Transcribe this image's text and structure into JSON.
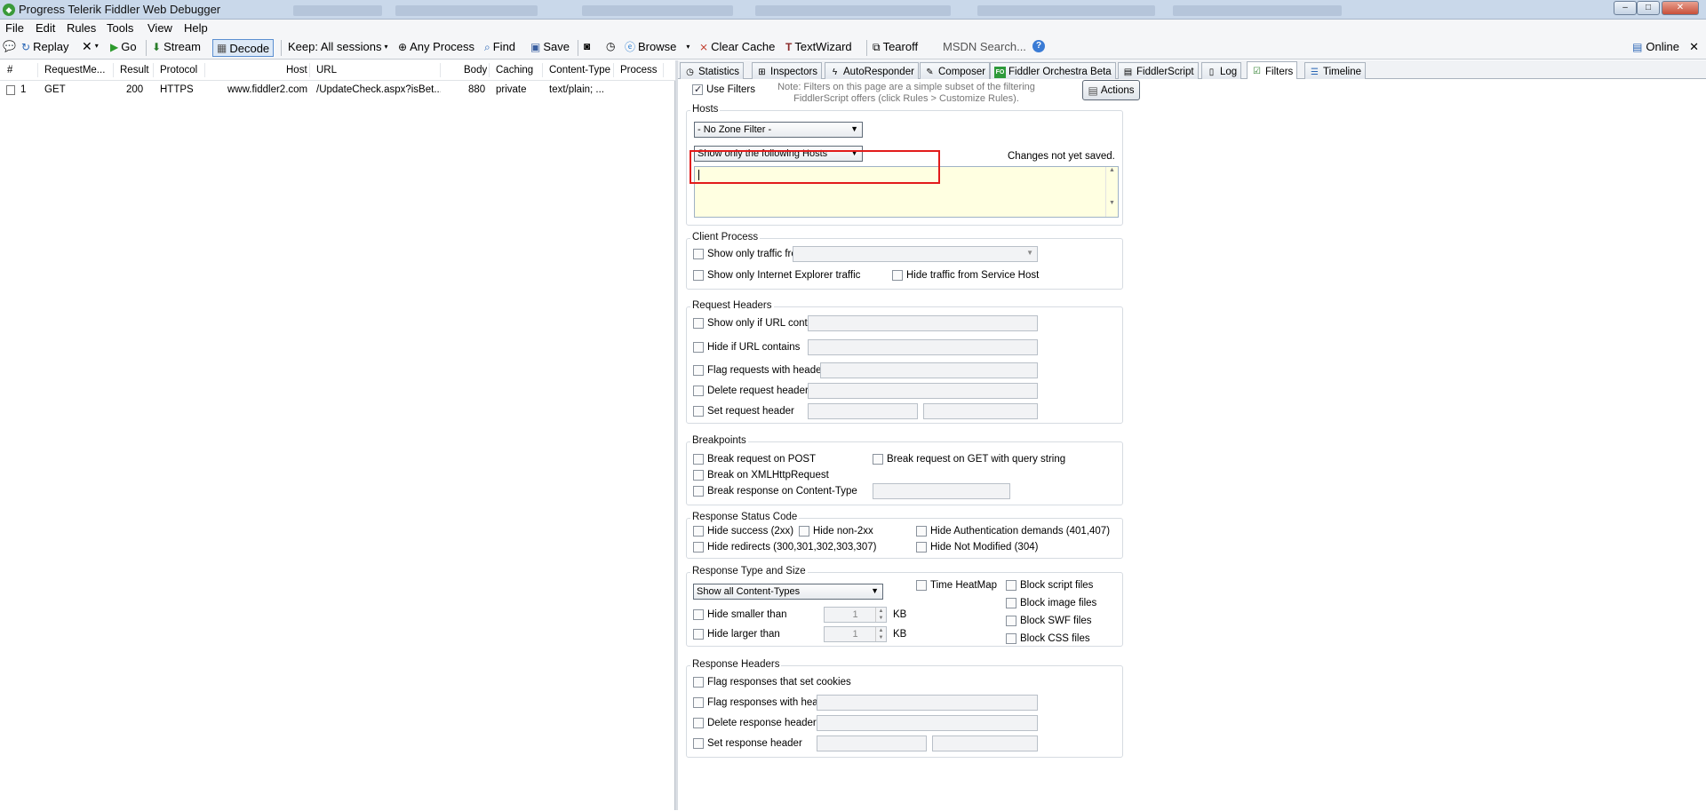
{
  "window": {
    "title": "Progress Telerik Fiddler Web Debugger"
  },
  "menu": [
    "File",
    "Edit",
    "Rules",
    "Tools",
    "View",
    "Help"
  ],
  "toolbar": {
    "replay": "Replay",
    "go": "Go",
    "stream": "Stream",
    "decode": "Decode",
    "keep": "Keep: All sessions",
    "any_process": "Any Process",
    "find": "Find",
    "save": "Save",
    "browse": "Browse",
    "clear_cache": "Clear Cache",
    "text_wizard": "TextWizard",
    "tearoff": "Tearoff",
    "msdn_search": "MSDN Search...",
    "online": "Online"
  },
  "sessions": {
    "columns": [
      "#",
      "RequestMe...",
      "Result",
      "Protocol",
      "Host",
      "URL",
      "Body",
      "Caching",
      "Content-Type",
      "Process"
    ],
    "rows": [
      {
        "id": "1",
        "method": "GET",
        "result": "200",
        "protocol": "HTTPS",
        "host": "www.fiddler2.com",
        "url": "/UpdateCheck.aspx?isBet...",
        "body": "880",
        "caching": "private",
        "content_type": "text/plain; ...",
        "process": ""
      }
    ]
  },
  "tabs": [
    "Statistics",
    "Inspectors",
    "AutoResponder",
    "Composer",
    "Fiddler Orchestra Beta",
    "FiddlerScript",
    "Log",
    "Filters",
    "Timeline"
  ],
  "tab_icons": {
    "fiddler_orchestra": "FO"
  },
  "filters": {
    "use_filters": "Use Filters",
    "note": "Note: Filters on this page are a simple subset of the filtering FiddlerScript offers (click Rules > Customize Rules).",
    "actions": "Actions",
    "hosts": {
      "title": "Hosts",
      "zone_filter": "- No Zone Filter -",
      "host_filter": "Show only the following Hosts",
      "changes_status": "Changes not yet saved."
    },
    "client_process": {
      "title": "Client Process",
      "show_only_traffic_from": "Show only traffic from",
      "show_only_ie": "Show only Internet Explorer traffic",
      "hide_service_host": "Hide traffic from Service Host"
    },
    "request_headers": {
      "title": "Request Headers",
      "show_if_url": "Show only if URL contains",
      "hide_if_url": "Hide if URL contains",
      "flag_requests": "Flag requests with headers",
      "delete_request": "Delete request headers",
      "set_request": "Set request header"
    },
    "breakpoints": {
      "title": "Breakpoints",
      "post": "Break request on POST",
      "get_query": "Break request on GET with query string",
      "xhr": "Break on XMLHttpRequest",
      "content_type": "Break response on Content-Type"
    },
    "status_code": {
      "title": "Response Status Code",
      "hide_success": "Hide success (2xx)",
      "hide_non2xx": "Hide non-2xx",
      "hide_auth": "Hide Authentication demands (401,407)",
      "hide_redirects": "Hide redirects (300,301,302,303,307)",
      "hide_not_modified": "Hide Not Modified (304)"
    },
    "type_size": {
      "title": "Response Type and Size",
      "content_types": "Show all Content-Types",
      "time_heatmap": "Time HeatMap",
      "block_script": "Block script files",
      "block_image": "Block image files",
      "block_swf": "Block SWF files",
      "block_css": "Block CSS files",
      "hide_smaller": "Hide smaller than",
      "hide_larger": "Hide larger than",
      "smaller_value": "1",
      "larger_value": "1",
      "unit": "KB"
    },
    "response_headers": {
      "title": "Response Headers",
      "flag_cookies": "Flag responses that set cookies",
      "flag_responses": "Flag responses with headers",
      "delete_response": "Delete response headers",
      "set_response": "Set response header"
    }
  },
  "colors": {
    "highlight": "#e21b1b",
    "hostlist_bg": "#ffffe1"
  }
}
